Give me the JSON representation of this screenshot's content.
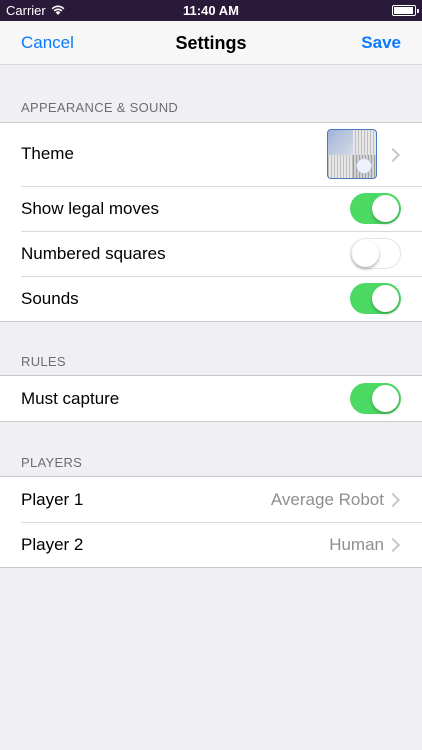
{
  "status_bar": {
    "carrier": "Carrier",
    "time": "11:40 AM"
  },
  "nav": {
    "cancel": "Cancel",
    "title": "Settings",
    "save": "Save"
  },
  "sections": {
    "appearance": {
      "header": "APPEARANCE & SOUND",
      "theme_label": "Theme",
      "show_legal_moves": {
        "label": "Show legal moves",
        "on": true
      },
      "numbered_squares": {
        "label": "Numbered squares",
        "on": false
      },
      "sounds": {
        "label": "Sounds",
        "on": true
      }
    },
    "rules": {
      "header": "RULES",
      "must_capture": {
        "label": "Must capture",
        "on": true
      }
    },
    "players": {
      "header": "PLAYERS",
      "player1": {
        "label": "Player 1",
        "value": "Average Robot"
      },
      "player2": {
        "label": "Player 2",
        "value": "Human"
      }
    }
  },
  "colors": {
    "accent": "#0a7aff",
    "toggle_on": "#4cd964",
    "status_bar_bg": "#2a1a3a"
  }
}
